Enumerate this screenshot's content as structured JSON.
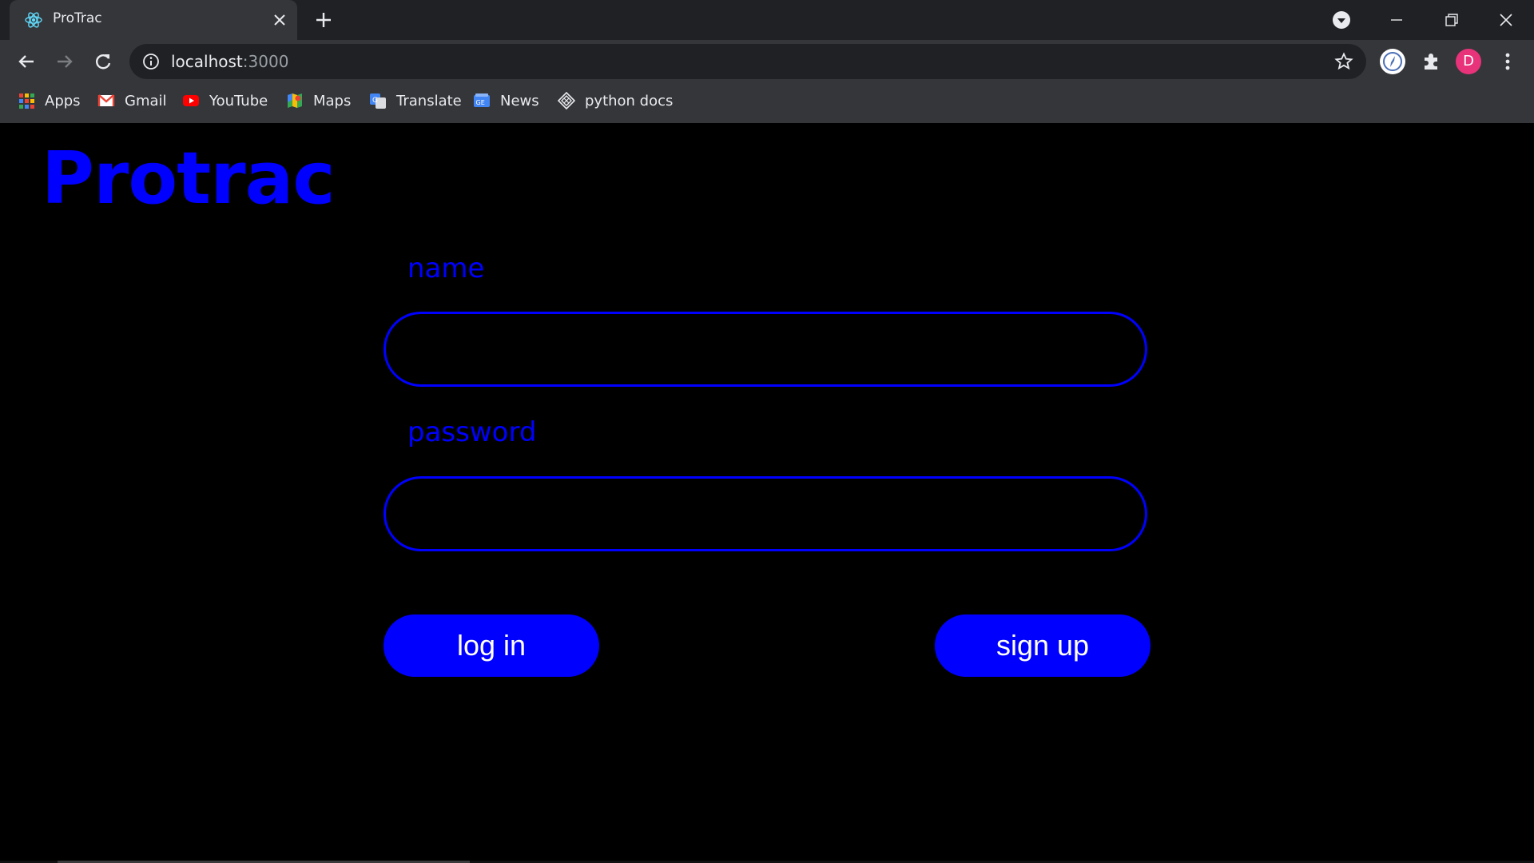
{
  "browser": {
    "tab": {
      "title": "ProTrac",
      "favicon": "react-atom-icon"
    },
    "address": {
      "host": "localhost",
      "port": ":3000"
    },
    "profile_initial": "D",
    "bookmarks": [
      {
        "label": "Apps",
        "icon": "apps-grid-icon"
      },
      {
        "label": "Gmail",
        "icon": "gmail-icon"
      },
      {
        "label": "YouTube",
        "icon": "youtube-icon"
      },
      {
        "label": "Maps",
        "icon": "maps-icon"
      },
      {
        "label": "Translate",
        "icon": "translate-icon"
      },
      {
        "label": "News",
        "icon": "news-icon"
      },
      {
        "label": "python docs",
        "icon": "python-docs-icon"
      }
    ]
  },
  "page": {
    "brand": "Protrac",
    "form": {
      "name_label": "name",
      "name_value": "",
      "password_label": "password",
      "password_value": "",
      "login_label": "log in",
      "signup_label": "sign up"
    }
  },
  "colors": {
    "accent": "#0000ff",
    "background": "#000000",
    "button_text": "#ffffff",
    "chrome": "#35363a"
  }
}
